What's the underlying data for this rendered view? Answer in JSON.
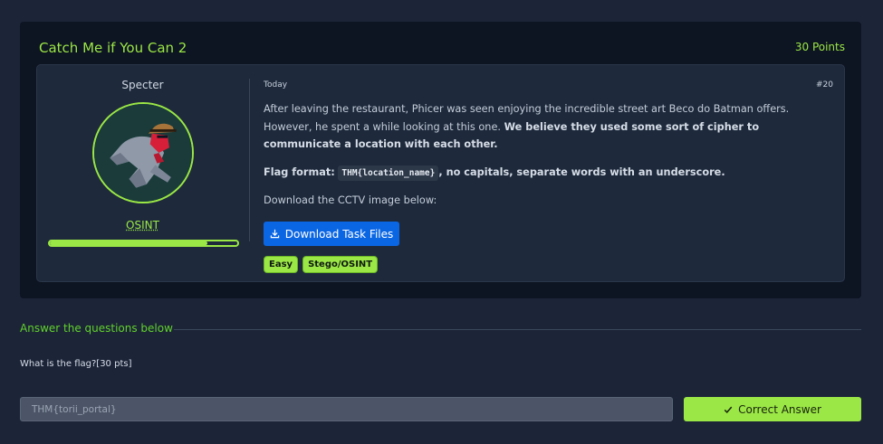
{
  "task": {
    "title": "Catch Me if You Can 2",
    "points": "30 Points",
    "author": "Specter",
    "category": "OSINT",
    "progress_percent": 84,
    "date": "Today",
    "number": "#20",
    "description_plain": "After leaving the restaurant, Phicer was seen enjoying the incredible street art Beco do Batman offers. However, he spent a while looking at this one. ",
    "description_bold": "We believe they used some sort of cipher to communicate a location with each other.",
    "flag_format_label": "Flag format:",
    "flag_format_code": "THM{location_name}",
    "flag_format_rest": ", no capitals, separate words with an underscore.",
    "download_text": "Download the CCTV image below:",
    "download_button": "Download Task Files",
    "tags": [
      "Easy",
      "Stego/OSINT"
    ]
  },
  "questions": {
    "heading": "Answer the questions below",
    "items": [
      {
        "text": "What is the flag?[30 pts]",
        "answer_value": "THM{torii_portal}",
        "submit_label": "Correct Answer"
      }
    ]
  },
  "colors": {
    "accent_green": "#9be745",
    "heading_green": "#61d12b",
    "button_blue": "#0b66e4",
    "background": "#1c2538",
    "card": "#0d1422"
  }
}
